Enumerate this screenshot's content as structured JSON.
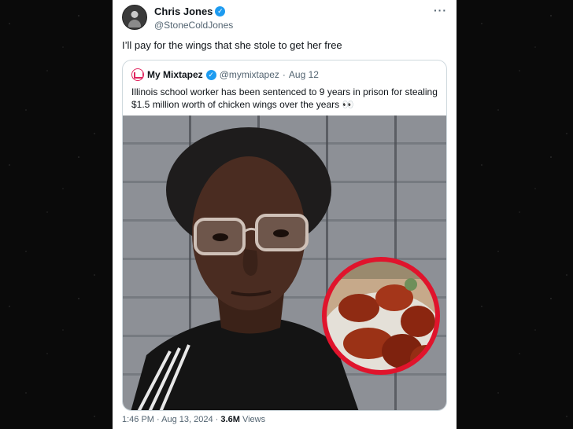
{
  "tweet": {
    "author_name": "Chris Jones",
    "author_handle": "@StoneColdJones",
    "more_icon": "more-horizontal-icon",
    "text": "I’ll pay for the wings that she stole to get her free",
    "time": "1:46 PM",
    "date": "Aug 13, 2024",
    "views_count": "3.6M",
    "views_label": "Views",
    "separator": "·"
  },
  "quote": {
    "name": "My Mixtapez",
    "handle": "@mymixtapez",
    "date": "Aug 12",
    "separator": "·",
    "text": "Illinois school worker has been sentenced to 9 years in prison for stealing $1.5 million worth of chicken wings over the years 👀"
  },
  "colors": {
    "accent_verified": "#1d9bf0",
    "highlight_circle": "#e0142c",
    "background": "#0b0b0b"
  }
}
